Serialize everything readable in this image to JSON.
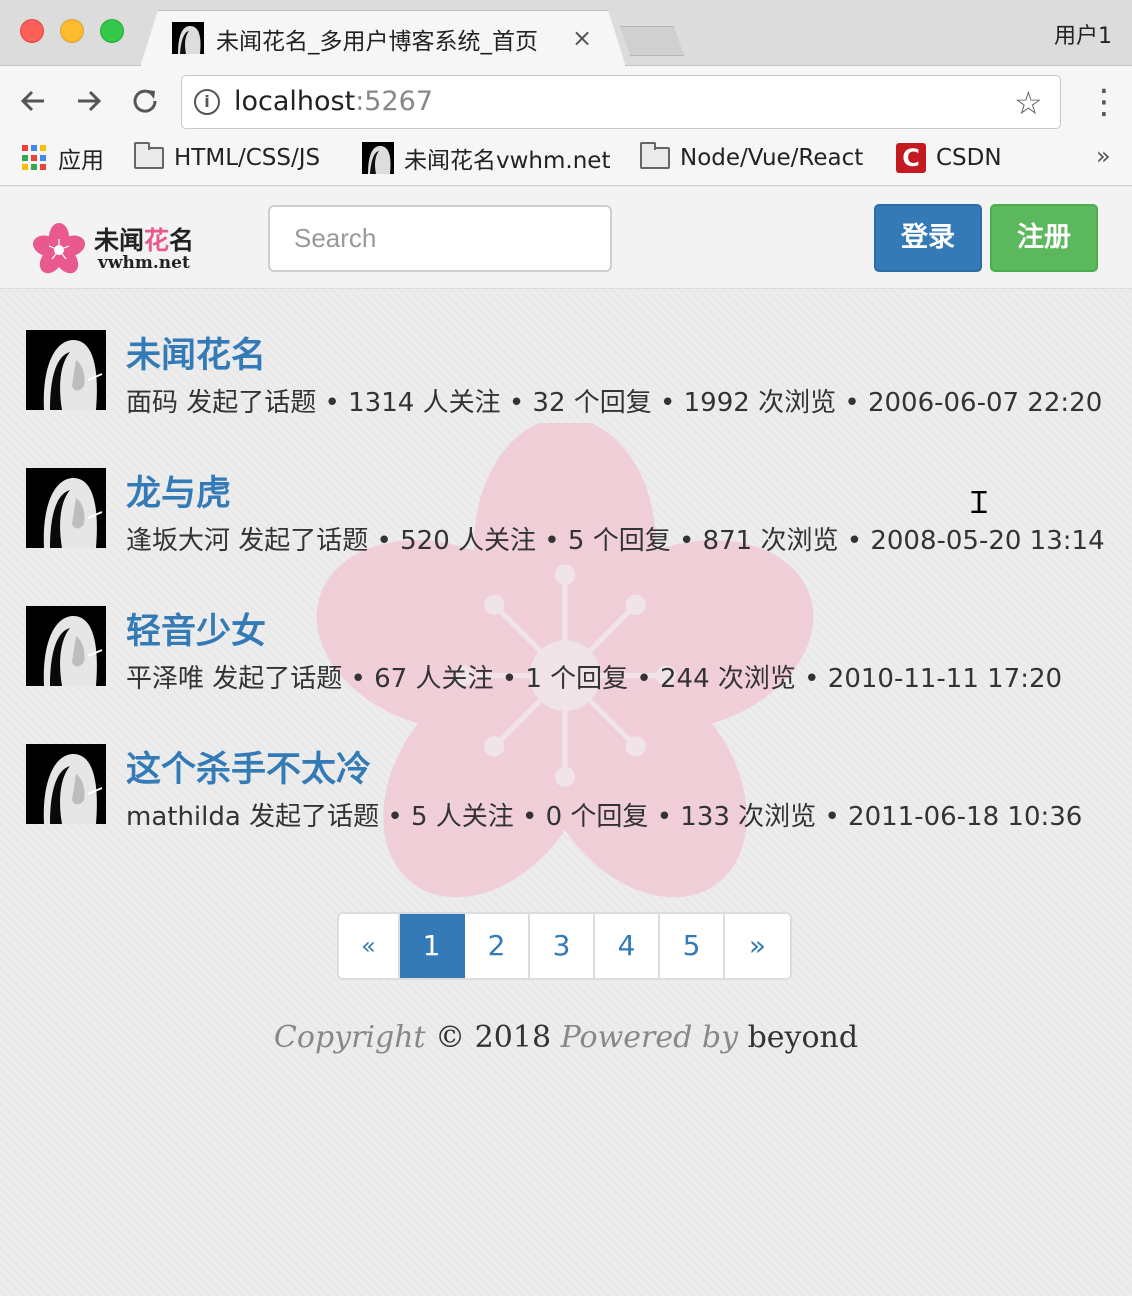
{
  "browser": {
    "tab_title": "未闻花名_多用户博客系统_首页",
    "tab_close": "×",
    "profile": "用户1",
    "url_host": "localhost",
    "url_port": ":5267",
    "bookmarks": [
      {
        "label": "应用",
        "icon": "apps-grid-icon"
      },
      {
        "label": "HTML/CSS/JS",
        "icon": "folder-icon"
      },
      {
        "label": "未闻花名vwhm.net",
        "icon": "avatar-favicon"
      },
      {
        "label": "Node/Vue/React",
        "icon": "folder-icon"
      },
      {
        "label": "CSDN",
        "icon": "csdn-icon"
      }
    ],
    "more": "»"
  },
  "navbar": {
    "logo_main": "未闻",
    "logo_accent": "花",
    "logo_end": "名",
    "logo_sub": "vwhm.net",
    "search_placeholder": "Search",
    "login": "登录",
    "register": "注册",
    "accent_colors": {
      "primary": "#337ab7",
      "success": "#5cb85c",
      "logo_pink": "#e85a8e"
    }
  },
  "topics": [
    {
      "title": "未闻花名",
      "meta": "面码 发起了话题 • 1314 人关注 • 32 个回复 • 1992 次浏览 • 2006-06-07 22:20"
    },
    {
      "title": "龙与虎",
      "meta": "逢坂大河 发起了话题 • 520 人关注 • 5 个回复 • 871 次浏览 • 2008-05-20 13:14"
    },
    {
      "title": "轻音少女",
      "meta": "平泽唯 发起了话题 • 67 人关注 • 1 个回复 • 244 次浏览 • 2010-11-11 17:20"
    },
    {
      "title": "这个杀手不太冷",
      "meta": "mathilda 发起了话题 • 5 人关注 • 0 个回复 • 133 次浏览 • 2011-06-18 10:36"
    }
  ],
  "pagination": {
    "prev": "«",
    "pages": [
      "1",
      "2",
      "3",
      "4",
      "5"
    ],
    "active": "1",
    "next": "»"
  },
  "footer": {
    "copyright": "Copyright",
    "symbol_year": " © 2018 ",
    "powered_by": "Powered by",
    "author": " beyond"
  }
}
